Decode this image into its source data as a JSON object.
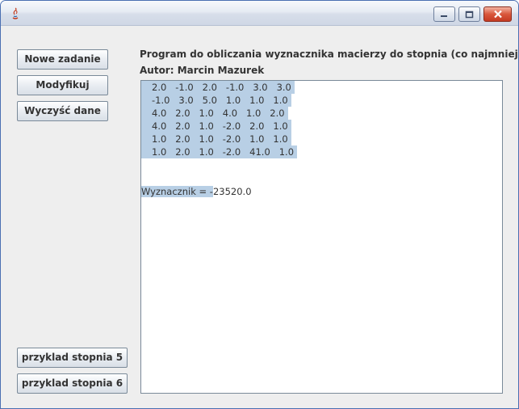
{
  "window": {
    "title": ""
  },
  "buttons": {
    "new_task": "Nowe zadanie",
    "modify": "Modyfikuj",
    "clear": "Wyczyść dane",
    "example5": "przyklad stopnia 5",
    "example6": "przyklad stopnia 6"
  },
  "header": {
    "title": "Program do obliczania wyznacznika macierzy do stopnia (co najmniej) piątego",
    "author": "Autor: Marcin Mazurek"
  },
  "textarea": {
    "matrix_rows": [
      "2.0   -1.0   2.0   -1.0   3.0   3.0",
      "-1.0   3.0   5.0   1.0   1.0   1.0",
      "4.0   2.0   1.0   4.0   1.0   2.0",
      "4.0   2.0   1.0   -2.0   2.0   1.0",
      "1.0   2.0   1.0   -2.0   1.0   1.0",
      "1.0   2.0   1.0   -2.0   41.0   1.0"
    ],
    "result_selected": "Wyznacznik = -",
    "result_rest": "23520.0"
  },
  "colors": {
    "selection": "#b8cfe5",
    "title_border": "#4a6fb2",
    "close_button": "#d9573c"
  }
}
